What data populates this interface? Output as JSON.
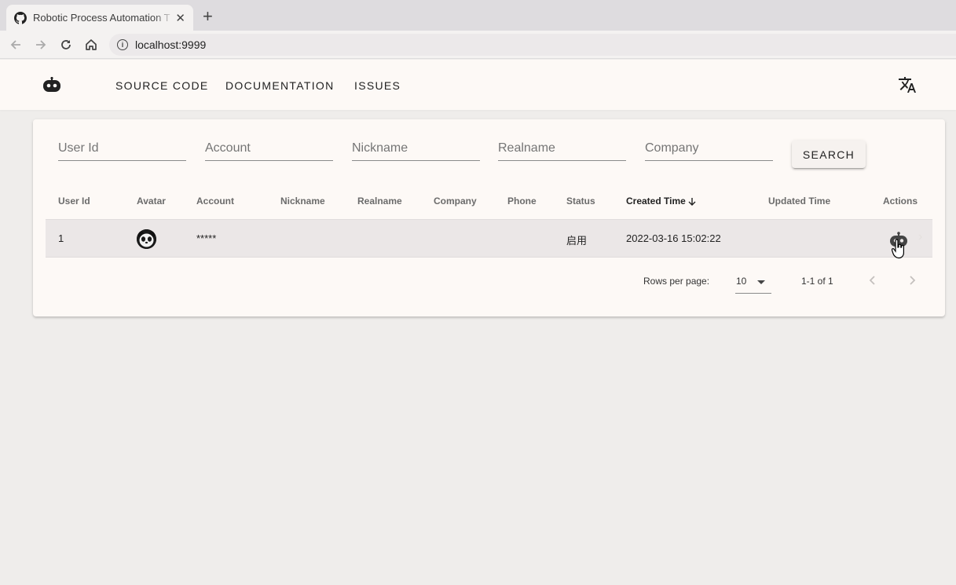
{
  "browser": {
    "tab_title": "Robotic Process Automation T",
    "url": "localhost:9999"
  },
  "appbar": {
    "nav": [
      "SOURCE CODE",
      "DOCUMENTATION",
      "ISSUES"
    ]
  },
  "filters": {
    "user_id": "User Id",
    "account": "Account",
    "nickname": "Nickname",
    "realname": "Realname",
    "company": "Company",
    "search_label": "SEARCH"
  },
  "table": {
    "headers": {
      "user_id": "User Id",
      "avatar": "Avatar",
      "account": "Account",
      "nickname": "Nickname",
      "realname": "Realname",
      "company": "Company",
      "phone": "Phone",
      "status": "Status",
      "created_time": "Created Time",
      "updated_time": "Updated Time",
      "actions": "Actions"
    },
    "sort": {
      "column": "created_time",
      "direction": "desc"
    },
    "rows": [
      {
        "user_id": "1",
        "account": "*****",
        "nickname": "",
        "realname": "",
        "company": "",
        "phone": "",
        "status": "启用",
        "created_time": "2022-03-16 15:02:22",
        "updated_time": ""
      }
    ]
  },
  "pagination": {
    "rows_per_page_label": "Rows per page:",
    "rows_per_page": "10",
    "range": "1-1 of 1"
  },
  "icons": {
    "tab": "github-icon",
    "logo": "robot-icon",
    "translate": "translate-icon",
    "action": "robot-icon"
  },
  "colors": {
    "page_bg": "#efedeb",
    "surface": "#fdf9f6",
    "row_hover": "#ebe7e7"
  }
}
